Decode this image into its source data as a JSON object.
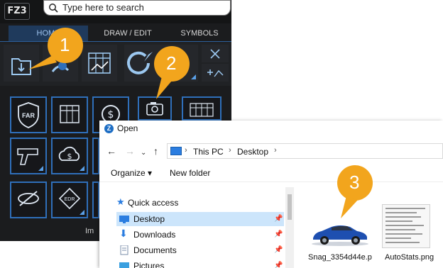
{
  "app": {
    "logo": "FZ3",
    "search_placeholder": "Type here to search",
    "tabs": [
      "HOME",
      "DRAW / EDIT",
      "SYMBOLS"
    ],
    "bottom_label": "Im"
  },
  "grid_icons": [
    "FAR"
  ],
  "callouts": [
    "1",
    "2",
    "3"
  ],
  "dialog": {
    "title": "Open",
    "address": [
      "This PC",
      "Desktop"
    ],
    "organize": "Organize",
    "new_folder": "New folder",
    "nav": [
      {
        "label": "Quick access",
        "pinned": false
      },
      {
        "label": "Desktop",
        "pinned": true
      },
      {
        "label": "Downloads",
        "pinned": true
      },
      {
        "label": "Documents",
        "pinned": true
      },
      {
        "label": "Pictures",
        "pinned": true
      }
    ],
    "files": [
      {
        "name": "Snag_3354d44e.p"
      },
      {
        "name": "AutoStats.png"
      }
    ]
  },
  "colors": {
    "accent": "#2f6fba",
    "callout": "#f2a51d",
    "selection": "#cce5fb"
  }
}
